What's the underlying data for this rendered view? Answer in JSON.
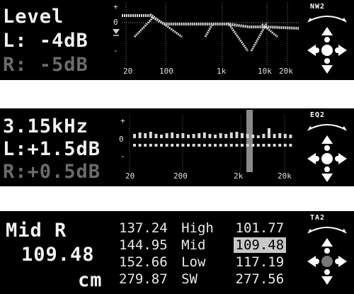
{
  "panel_level": {
    "title": "Level",
    "left": "L:  -4dB",
    "right": "R:  -5dB",
    "scale_plus": "+",
    "scale_zero": "0",
    "scale_minus": "-",
    "freq_ticks": [
      "20",
      "100",
      "1k",
      "10k",
      "20k"
    ],
    "badge": "NW2",
    "marker_icon": "triangle-down-icon"
  },
  "panel_eq": {
    "frequency": "3.15kHz",
    "left": "L:+1.5dB",
    "right": "R:+0.5dB",
    "scale_plus": "+",
    "scale_zero": "0",
    "scale_minus": "-",
    "freq_ticks": [
      "20",
      "200",
      "2k",
      "20k"
    ],
    "badge": "EQ2"
  },
  "panel_ta": {
    "title": "Mid R",
    "value": "109.48",
    "unit": "cm",
    "badge": "TA2",
    "rows": [
      {
        "left": "137.24",
        "label": "High",
        "right": "101.77"
      },
      {
        "left": "144.95",
        "label": "Mid",
        "right": "109.48"
      },
      {
        "left": "152.66",
        "label": "Low",
        "right": "117.19"
      },
      {
        "left": "279.87",
        "label": "SW",
        "right": "277.56"
      }
    ]
  }
}
